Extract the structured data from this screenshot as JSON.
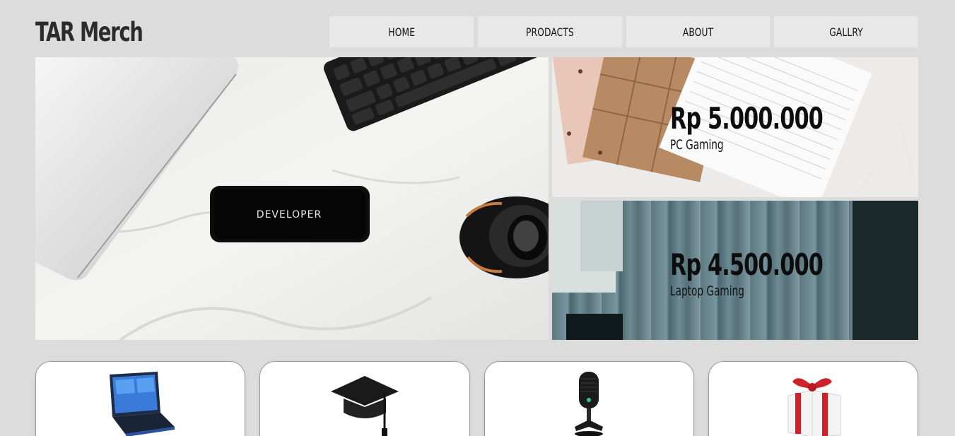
{
  "header": {
    "logo_text": "TAR Merch"
  },
  "nav": {
    "items": [
      {
        "label": "HOME"
      },
      {
        "label": "PRODACTS"
      },
      {
        "label": "ABOUT"
      },
      {
        "label": "GALLRY"
      }
    ]
  },
  "hero": {
    "main_image": {
      "icon": "developer-desk-photo",
      "phone_text": "DEVELOPER"
    },
    "promos": [
      {
        "price": "Rp 5.000.000",
        "label": "PC Gaming",
        "icon": "notebooks-pens-photo"
      },
      {
        "price": "Rp 4.500.000",
        "label": "Laptop Gaming",
        "icon": "wood-table-photo"
      }
    ]
  },
  "products": [
    {
      "icon": "laptop-icon"
    },
    {
      "icon": "graduation-cap-icon"
    },
    {
      "icon": "microphone-icon"
    },
    {
      "icon": "gift-box-icon"
    }
  ],
  "colors": {
    "background": "#dcdcdc",
    "nav_bg": "#e8e8e8",
    "card_bg": "#ffffff",
    "gift_ribbon": "#d0202a"
  }
}
